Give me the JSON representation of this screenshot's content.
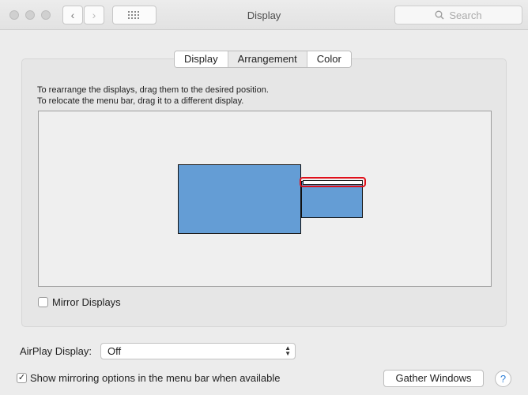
{
  "window": {
    "title": "Display"
  },
  "toolbar": {
    "search_placeholder": "Search",
    "back_glyph": "‹",
    "forward_glyph": "›"
  },
  "tabs": [
    {
      "label": "Display",
      "selected": false
    },
    {
      "label": "Arrangement",
      "selected": true
    },
    {
      "label": "Color",
      "selected": false
    }
  ],
  "arrangement": {
    "instruction_1": "To rearrange the displays, drag them to the desired position.",
    "instruction_2": "To relocate the menu bar, drag it to a different display.",
    "display_color": "#649dd5",
    "highlight_color": "#e0101a"
  },
  "mirror": {
    "label": "Mirror Displays",
    "checked": false
  },
  "airplay": {
    "label": "AirPlay Display:",
    "value": "Off"
  },
  "show_mirroring": {
    "label": "Show mirroring options in the menu bar when available",
    "checked": true,
    "check_glyph": "✓"
  },
  "gather_button": {
    "label": "Gather Windows"
  },
  "help_button": {
    "label": "?"
  }
}
